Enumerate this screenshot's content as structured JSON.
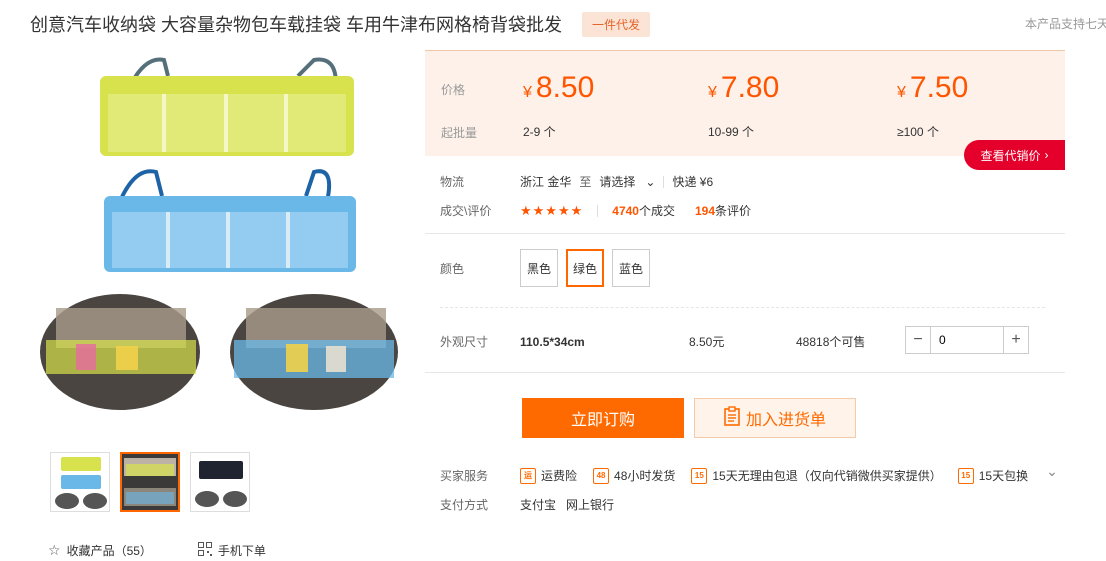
{
  "header": {
    "title": "创意汽车收纳袋 大容量杂物包车载挂袋 车用牛津布网格椅背袋批发",
    "tag": "一件代发",
    "support_note": "本产品支持七天"
  },
  "price": {
    "price_label": "价格",
    "moq_label": "起批量",
    "currency": "¥",
    "tiers": [
      {
        "price": "8.50",
        "qty": "2-9 个"
      },
      {
        "price": "7.80",
        "qty": "10-99 个"
      },
      {
        "price": "7.50",
        "qty": "≥100 个"
      }
    ],
    "agent_price_button": "查看代销价"
  },
  "logistics": {
    "label": "物流",
    "origin": "浙江 金华",
    "to": "至",
    "destination": "请选择",
    "express": "快递 ¥6"
  },
  "deals": {
    "label": "成交\\评价",
    "stars": "★★★★★",
    "deal_count": "4740",
    "deal_suffix": "个成交",
    "review_count": "194",
    "review_suffix": "条评价"
  },
  "color": {
    "label": "颜色",
    "options": [
      "黑色",
      "绿色",
      "蓝色"
    ],
    "selected": "绿色"
  },
  "size": {
    "label": "外观尺寸",
    "value": "110.5*34cm",
    "price": "8.50元",
    "stock": "48818个可售",
    "quantity": "0"
  },
  "actions": {
    "buy_now": "立即订购",
    "add_to_list": "加入进货单"
  },
  "services": {
    "label": "买家服务",
    "items": [
      {
        "icon": "freight-insurance-icon",
        "glyph": "运",
        "text": "运费险"
      },
      {
        "icon": "48h-ship-icon",
        "glyph": "48",
        "text": "48小时发货"
      },
      {
        "icon": "15day-return-icon",
        "glyph": "15",
        "text": "15天无理由包退（仅向代销微供买家提供）"
      },
      {
        "icon": "15day-exchange-icon",
        "glyph": "15",
        "text": "15天包换"
      }
    ]
  },
  "payment": {
    "label": "支付方式",
    "methods": [
      "支付宝",
      "网上银行"
    ]
  },
  "footer": {
    "favorite": "收藏产品（55）",
    "mobile_order": "手机下单"
  },
  "colors": {
    "accent": "#ff6a00",
    "price": "#ff5500",
    "agent_button": "#e4002b",
    "bag_green": "#d8e24c",
    "bag_blue": "#6ab8e8"
  }
}
